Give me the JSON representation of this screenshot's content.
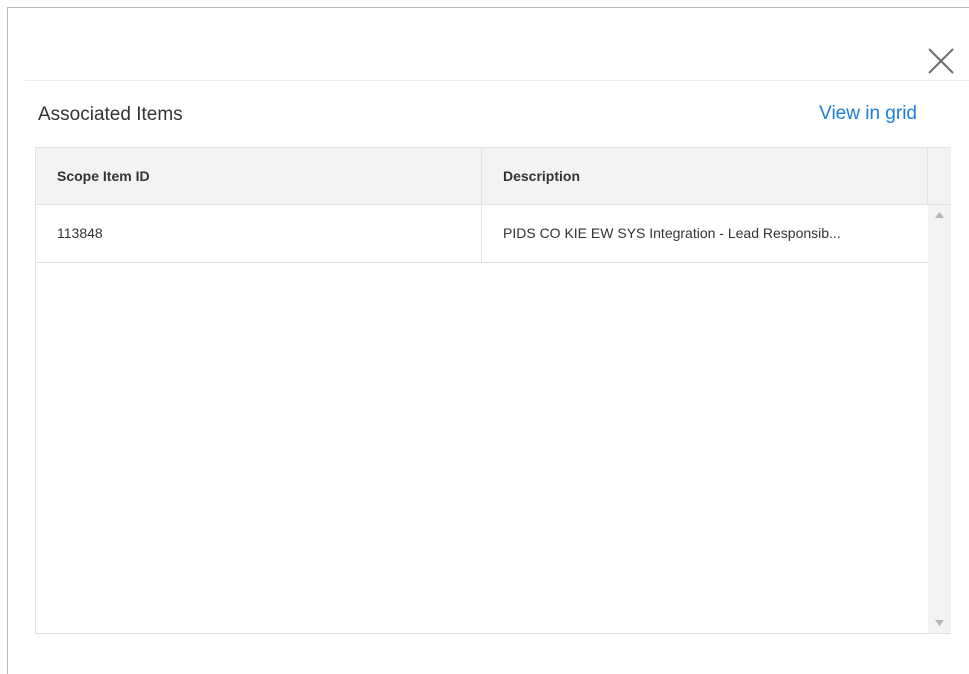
{
  "dialog": {
    "section_title": "Associated Items",
    "view_in_grid_label": "View in grid"
  },
  "table": {
    "columns": [
      "Scope Item ID",
      "Description"
    ],
    "rows": [
      {
        "scope_item_id": "113848",
        "description": "PIDS CO KIE EW SYS Integration - Lead Responsib..."
      }
    ]
  },
  "icons": {
    "close": "close-icon",
    "scroll_up": "caret-up-icon",
    "scroll_down": "caret-down-icon"
  },
  "colors": {
    "link": "#1a7fd9",
    "header_bg": "#f3f3f3",
    "text": "#333333"
  }
}
